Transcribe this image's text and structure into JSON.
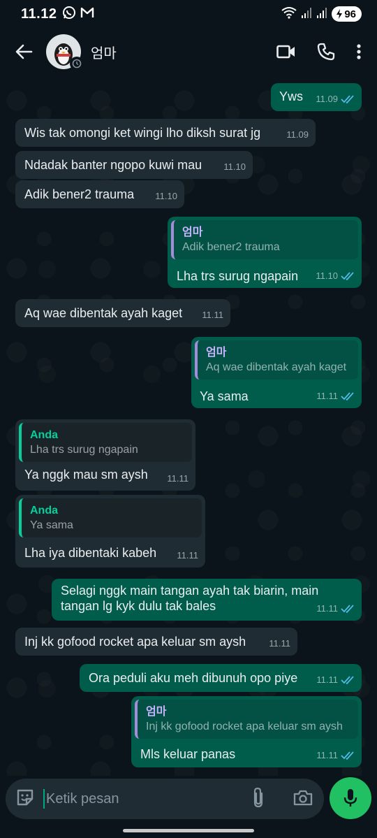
{
  "status": {
    "time": "11.12",
    "battery": "96"
  },
  "header": {
    "contact_name": "엄마"
  },
  "messages": [
    {
      "text": "Yws",
      "time": "11.09"
    },
    {
      "text": "Wis tak omongi ket wingi lho diksh surat jg",
      "time": "11.09"
    },
    {
      "text": "Ndadak banter ngopo kuwi mau",
      "time": "11.10"
    },
    {
      "text": "Adik bener2 trauma",
      "time": "11.10"
    },
    {
      "quote_name": "엄마",
      "quote_text": "Adik bener2 trauma",
      "text": "Lha trs surug ngapain",
      "time": "11.10"
    },
    {
      "text": "Aq wae dibentak ayah kaget",
      "time": "11.11"
    },
    {
      "quote_name": "엄마",
      "quote_text": "Aq wae dibentak ayah kaget",
      "text": "Ya sama",
      "time": "11.11"
    },
    {
      "quote_name": "Anda",
      "quote_text": "Lha trs surug ngapain",
      "text": "Ya nggk mau sm aysh",
      "time": "11.11"
    },
    {
      "quote_name": "Anda",
      "quote_text": "Ya sama",
      "text": "Lha iya dibentaki kabeh",
      "time": "11.11"
    },
    {
      "text_line1": "Selagi nggk main tangan ayah tak biarin, main",
      "text_line2": "tangan lg kyk dulu tak bales",
      "time": "11.11"
    },
    {
      "text": "Inj kk gofood rocket apa keluar sm aysh",
      "time": "11.11"
    },
    {
      "text": "Ora peduli aku meh dibunuh opo piye",
      "time": "11.11"
    },
    {
      "quote_name": "엄마",
      "quote_text": "Inj kk gofood rocket apa keluar sm aysh",
      "text": "Mls keluar panas",
      "time": "11.11"
    }
  ],
  "composer": {
    "placeholder": "Ketik pesan"
  },
  "colors": {
    "incoming": "#202c33",
    "outgoing": "#005c4b",
    "accent": "#21c063",
    "tick_read": "#53bdeb"
  }
}
